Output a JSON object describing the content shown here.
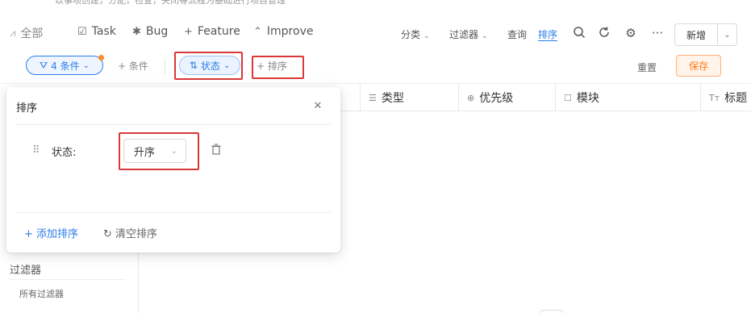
{
  "header": {
    "subtitle": "以事项创建，分配，检查，关闭等流程为基础进行项目管理"
  },
  "tabs": [
    {
      "label": "全部",
      "icon": "all-icon",
      "glyph": "⩘"
    },
    {
      "label": "Task",
      "icon": "task-icon",
      "glyph": "☑"
    },
    {
      "label": "Bug",
      "icon": "bug-icon",
      "glyph": "✱"
    },
    {
      "label": "Feature",
      "icon": "plus-icon",
      "glyph": "+"
    },
    {
      "label": "Improve",
      "icon": "chevron-up-icon",
      "glyph": "⌃"
    }
  ],
  "view": {
    "group_label": "分类",
    "filter_label": "过滤器",
    "query_label": "查询",
    "sort_label": "排序",
    "new_label": "新增"
  },
  "filterbar": {
    "conditions_label": "4 条件",
    "add_condition_label": "+ 条件",
    "status_sort_label": "状态",
    "add_sort_label": "+ 排序",
    "reset_label": "重置",
    "save_label": "保存"
  },
  "table": {
    "columns": [
      {
        "label": "类型",
        "icon": "list-icon",
        "glyph": "☰"
      },
      {
        "label": "优先级",
        "icon": "arrow-circle-icon",
        "glyph": "⊕"
      },
      {
        "label": "模块",
        "icon": "checkbox-icon",
        "glyph": "☐"
      },
      {
        "label": "标题",
        "icon": "text-type-icon",
        "glyph": "Tт"
      }
    ]
  },
  "sidebar": {
    "filters_title": "过滤器",
    "all_filters_label": "所有过滤器"
  },
  "sort_popover": {
    "title": "排序",
    "rules": [
      {
        "field": "状态:",
        "order": "升序"
      }
    ],
    "add_sort_label": "+ 添加排序",
    "clear_sort_label": "清空排序"
  },
  "colors": {
    "accent": "#2b7de9",
    "save": "#ff7a1a",
    "highlight": "#d93838"
  }
}
